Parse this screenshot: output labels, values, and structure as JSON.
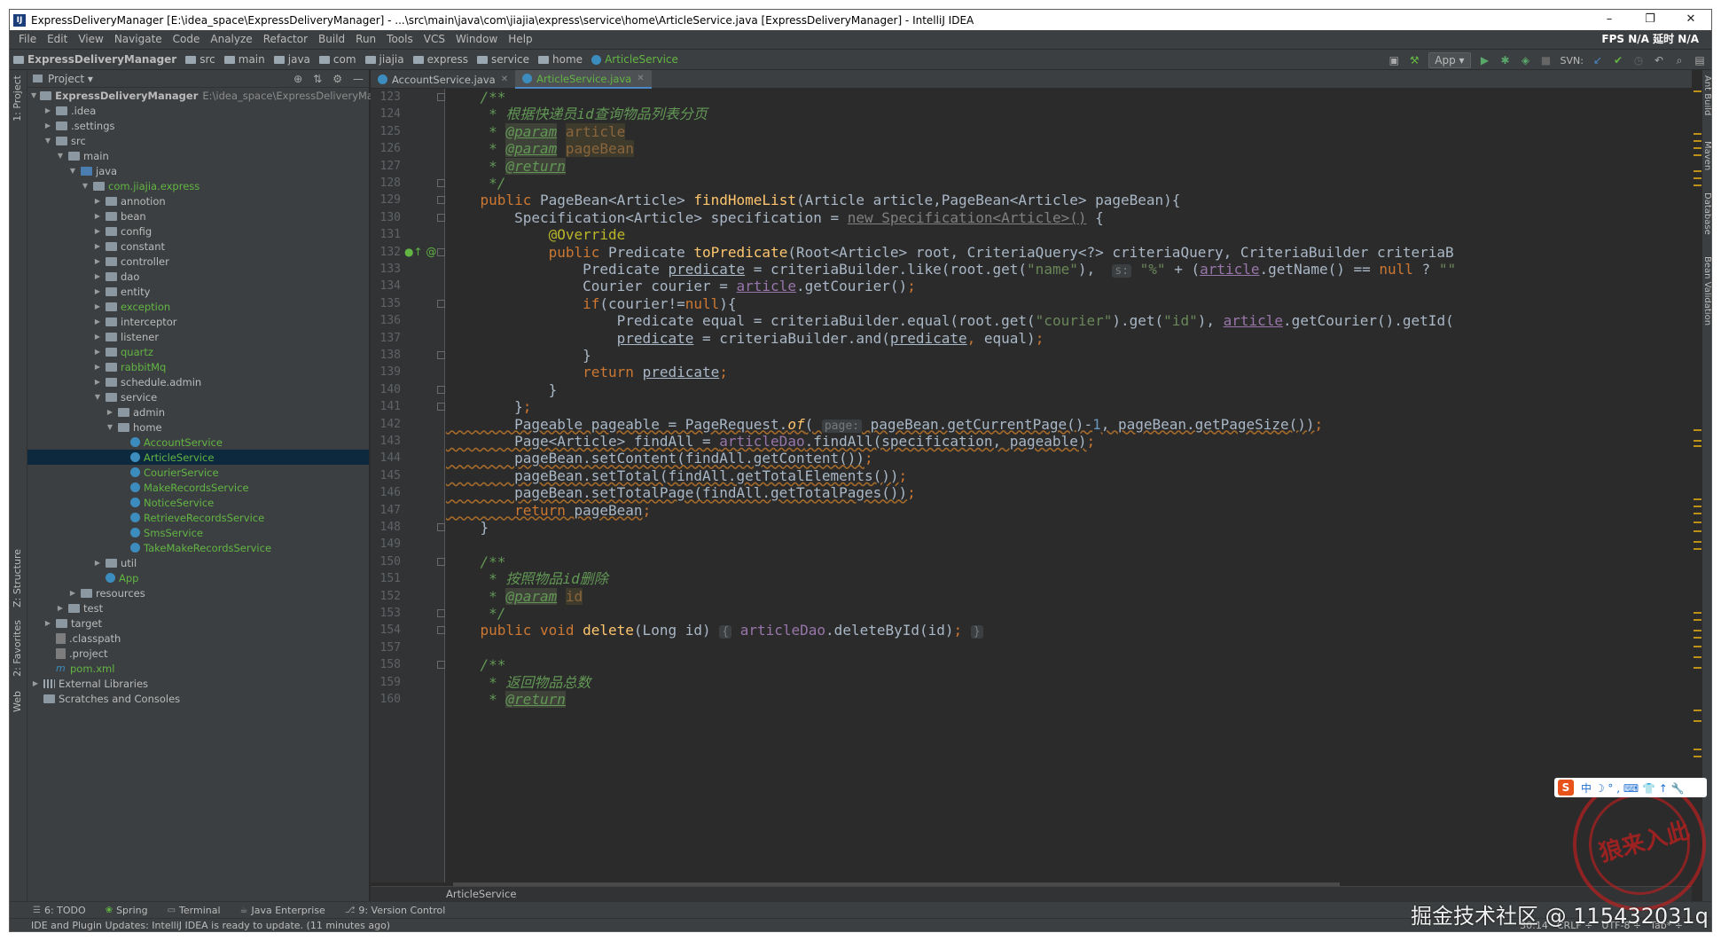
{
  "window": {
    "title": "ExpressDeliveryManager [E:\\idea_space\\ExpressDeliveryManager] - ...\\src\\main\\java\\com\\jiajia\\express\\service\\home\\ArticleService.java [ExpressDeliveryManager] - IntelliJ IDEA",
    "app_icon": "IJ",
    "controls": {
      "minimize": "–",
      "maximize": "❐",
      "close": "✕"
    }
  },
  "menu": {
    "items": [
      "File",
      "Edit",
      "View",
      "Navigate",
      "Code",
      "Analyze",
      "Refactor",
      "Build",
      "Run",
      "Tools",
      "VCS",
      "Window",
      "Help"
    ],
    "right_status": "FPS  N/A  延时  N/A"
  },
  "navbar": {
    "crumbs": [
      "ExpressDeliveryManager",
      "src",
      "main",
      "java",
      "com",
      "jiajia",
      "express",
      "service",
      "home",
      "ArticleService"
    ],
    "run_config": "App ▾",
    "svn_label": "SVN:"
  },
  "left_stripe": {
    "project": "1: Project",
    "structure": "Z: Structure",
    "favorites": "2: Favorites",
    "web": "Web"
  },
  "project_panel": {
    "header": "Project ▾",
    "tree": [
      {
        "label": "ExpressDeliveryManager",
        "path": "E:\\idea_space\\ExpressDeliveryManager",
        "indent": 0,
        "arrow": "down",
        "icon": "folder",
        "bold": true
      },
      {
        "label": ".idea",
        "indent": 1,
        "arrow": "right",
        "icon": "folder"
      },
      {
        "label": ".settings",
        "indent": 1,
        "arrow": "right",
        "icon": "folder"
      },
      {
        "label": "src",
        "indent": 1,
        "arrow": "down",
        "icon": "folder"
      },
      {
        "label": "main",
        "indent": 2,
        "arrow": "down",
        "icon": "folder"
      },
      {
        "label": "java",
        "indent": 3,
        "arrow": "down",
        "icon": "src"
      },
      {
        "label": "com.jiajia.express",
        "indent": 4,
        "arrow": "down",
        "icon": "pkg",
        "green": true
      },
      {
        "label": "annotion",
        "indent": 5,
        "arrow": "right",
        "icon": "pkg"
      },
      {
        "label": "bean",
        "indent": 5,
        "arrow": "right",
        "icon": "pkg"
      },
      {
        "label": "config",
        "indent": 5,
        "arrow": "right",
        "icon": "pkg"
      },
      {
        "label": "constant",
        "indent": 5,
        "arrow": "right",
        "icon": "pkg"
      },
      {
        "label": "controller",
        "indent": 5,
        "arrow": "right",
        "icon": "pkg"
      },
      {
        "label": "dao",
        "indent": 5,
        "arrow": "right",
        "icon": "pkg"
      },
      {
        "label": "entity",
        "indent": 5,
        "arrow": "right",
        "icon": "pkg"
      },
      {
        "label": "exception",
        "indent": 5,
        "arrow": "right",
        "icon": "pkg",
        "green": true
      },
      {
        "label": "interceptor",
        "indent": 5,
        "arrow": "right",
        "icon": "pkg"
      },
      {
        "label": "listener",
        "indent": 5,
        "arrow": "right",
        "icon": "pkg"
      },
      {
        "label": "quartz",
        "indent": 5,
        "arrow": "right",
        "icon": "pkg",
        "green": true
      },
      {
        "label": "rabbitMq",
        "indent": 5,
        "arrow": "right",
        "icon": "pkg",
        "green": true
      },
      {
        "label": "schedule.admin",
        "indent": 5,
        "arrow": "right",
        "icon": "pkg"
      },
      {
        "label": "service",
        "indent": 5,
        "arrow": "down",
        "icon": "pkg"
      },
      {
        "label": "admin",
        "indent": 6,
        "arrow": "right",
        "icon": "pkg"
      },
      {
        "label": "home",
        "indent": 6,
        "arrow": "down",
        "icon": "pkg"
      },
      {
        "label": "AccountService",
        "indent": 7,
        "arrow": "",
        "icon": "cls",
        "green": true
      },
      {
        "label": "ArticleService",
        "indent": 7,
        "arrow": "",
        "icon": "cls",
        "green": true,
        "selected": true
      },
      {
        "label": "CourierService",
        "indent": 7,
        "arrow": "",
        "icon": "cls",
        "green": true
      },
      {
        "label": "MakeRecordsService",
        "indent": 7,
        "arrow": "",
        "icon": "cls",
        "green": true
      },
      {
        "label": "NoticeService",
        "indent": 7,
        "arrow": "",
        "icon": "cls",
        "green": true
      },
      {
        "label": "RetrieveRecordsService",
        "indent": 7,
        "arrow": "",
        "icon": "cls",
        "green": true
      },
      {
        "label": "SmsService",
        "indent": 7,
        "arrow": "",
        "icon": "cls",
        "green": true
      },
      {
        "label": "TakeMakeRecordsService",
        "indent": 7,
        "arrow": "",
        "icon": "cls",
        "green": true
      },
      {
        "label": "util",
        "indent": 5,
        "arrow": "right",
        "icon": "pkg"
      },
      {
        "label": "App",
        "indent": 5,
        "arrow": "",
        "icon": "cls",
        "green": true
      },
      {
        "label": "resources",
        "indent": 3,
        "arrow": "right",
        "icon": "folder"
      },
      {
        "label": "test",
        "indent": 2,
        "arrow": "right",
        "icon": "folder"
      },
      {
        "label": "target",
        "indent": 1,
        "arrow": "right",
        "icon": "folder"
      },
      {
        "label": ".classpath",
        "indent": 1,
        "arrow": "",
        "icon": "file"
      },
      {
        "label": ".project",
        "indent": 1,
        "arrow": "",
        "icon": "file"
      },
      {
        "label": "pom.xml",
        "indent": 1,
        "arrow": "",
        "icon": "mvn",
        "green": true
      },
      {
        "label": "External Libraries",
        "indent": 0,
        "arrow": "right",
        "icon": "lib"
      },
      {
        "label": "Scratches and Consoles",
        "indent": 0,
        "arrow": "",
        "icon": "folder"
      }
    ]
  },
  "editor": {
    "tabs": [
      {
        "label": "AccountService.java",
        "active": false
      },
      {
        "label": "ArticleService.java",
        "active": true
      }
    ],
    "line_numbers": [
      "123",
      "124",
      "125",
      "126",
      "127",
      "128",
      "129",
      "130",
      "131",
      "132",
      "133",
      "134",
      "135",
      "136",
      "137",
      "138",
      "139",
      "140",
      "141",
      "142",
      "143",
      "144",
      "145",
      "146",
      "147",
      "148",
      "149",
      "150",
      "151",
      "152",
      "153",
      "154",
      "157",
      "158",
      "159",
      "160"
    ],
    "lines": [
      [
        [
          "cmt",
          "    /**"
        ]
      ],
      [
        [
          "cmt",
          "     * 根据快递员id查询物品列表分页"
        ]
      ],
      [
        [
          "cmt",
          "     * "
        ],
        [
          "cmt-tag",
          "@param"
        ],
        [
          "cmt",
          " "
        ],
        [
          "cmt-param",
          "article"
        ]
      ],
      [
        [
          "cmt",
          "     * "
        ],
        [
          "cmt-tag",
          "@param"
        ],
        [
          "cmt",
          " "
        ],
        [
          "cmt-param",
          "pageBean"
        ]
      ],
      [
        [
          "cmt",
          "     * "
        ],
        [
          "cmt-tag",
          "@return"
        ]
      ],
      [
        [
          "cmt",
          "     */"
        ]
      ],
      [
        [
          "kw",
          "    public "
        ],
        [
          "",
          "PageBean<Article> "
        ],
        [
          "fn",
          "findHomeList"
        ],
        [
          "",
          "(Article article,PageBean<Article> pageBean){"
        ]
      ],
      [
        [
          "",
          "        Specification<Article> specification = "
        ],
        [
          "deprec",
          "new Specification<Article>()"
        ],
        [
          "",
          " {"
        ]
      ],
      [
        [
          "ann",
          "            @Override"
        ]
      ],
      [
        [
          "kw",
          "            public "
        ],
        [
          "",
          "Predicate "
        ],
        [
          "fn",
          "toPredicate"
        ],
        [
          "",
          "(Root<Article> root, CriteriaQuery<?> criteriaQuery, CriteriaBuilder criteriaB"
        ]
      ],
      [
        [
          "",
          "                Predicate "
        ],
        [
          "ul",
          "predicate"
        ],
        [
          "",
          " = criteriaBuilder.like(root.get("
        ],
        [
          "str",
          "\"name\""
        ],
        [
          "",
          "),  "
        ],
        [
          "hint",
          "s:"
        ],
        [
          "str",
          " \"%\""
        ],
        [
          "",
          " + ("
        ],
        [
          "ul field",
          "article"
        ],
        [
          "",
          ".getName() == "
        ],
        [
          "kw",
          "null"
        ],
        [
          "",
          " ? "
        ],
        [
          "str",
          "\"\""
        ]
      ],
      [
        [
          "",
          "                Courier courier = "
        ],
        [
          "ul field",
          "article"
        ],
        [
          "",
          ".getCourier()"
        ],
        [
          "kw",
          ";"
        ]
      ],
      [
        [
          "kw",
          "                if"
        ],
        [
          "",
          "(courier!="
        ],
        [
          "kw",
          "null"
        ],
        [
          "",
          "){"
        ]
      ],
      [
        [
          "",
          "                    Predicate equal = criteriaBuilder.equal(root.get("
        ],
        [
          "str",
          "\"courier\""
        ],
        [
          "",
          ").get("
        ],
        [
          "str",
          "\"id\""
        ],
        [
          "",
          "), "
        ],
        [
          "ul field",
          "article"
        ],
        [
          "",
          ".getCourier().getId("
        ]
      ],
      [
        [
          "",
          "                    "
        ],
        [
          "ul",
          "predicate"
        ],
        [
          "",
          " = criteriaBuilder.and("
        ],
        [
          "ul",
          "predicate"
        ],
        [
          "kw",
          ", "
        ],
        [
          "",
          "equal)"
        ],
        [
          "kw",
          ";"
        ]
      ],
      [
        [
          "",
          "                }"
        ]
      ],
      [
        [
          "kw",
          "                return "
        ],
        [
          "ul",
          "predicate"
        ],
        [
          "kw",
          ";"
        ]
      ],
      [
        [
          "",
          "            }"
        ]
      ],
      [
        [
          "",
          "        }"
        ],
        [
          "kw",
          ";"
        ]
      ],
      [
        [
          "wavy",
          "        Pageable pageable = PageRequest."
        ],
        [
          "wavy fn-it",
          "of"
        ],
        [
          "wavy",
          "( "
        ],
        [
          "hint",
          "page:"
        ],
        [
          "wavy",
          " pageBean.getCurrentPage()-"
        ],
        [
          "num",
          "1"
        ],
        [
          "wavy",
          ", pageBean.getPageSize())"
        ],
        [
          "kw",
          ";"
        ]
      ],
      [
        [
          "wavy",
          "        Page<Article> findAll = "
        ],
        [
          "field wavy",
          "articleDao"
        ],
        [
          "wavy",
          ".findAll(specification, pageable)"
        ],
        [
          "kw",
          ";"
        ]
      ],
      [
        [
          "wavy",
          "        pageBean.setContent(findAll.getContent())"
        ],
        [
          "kw",
          ";"
        ]
      ],
      [
        [
          "wavy",
          "        pageBean.setTotal(findAll.getTotalElements())"
        ],
        [
          "kw",
          ";"
        ]
      ],
      [
        [
          "wavy",
          "        pageBean.setTotalPage(findAll.getTotalPages())"
        ],
        [
          "kw",
          ";"
        ]
      ],
      [
        [
          "kw wavy",
          "        return "
        ],
        [
          "wavy",
          "pageBean"
        ],
        [
          "kw",
          ";"
        ]
      ],
      [
        [
          "",
          "    }"
        ]
      ],
      [
        [
          "",
          ""
        ]
      ],
      [
        [
          "cmt",
          "    /**"
        ]
      ],
      [
        [
          "cmt",
          "     * 按照物品id删除"
        ]
      ],
      [
        [
          "cmt",
          "     * "
        ],
        [
          "cmt-tag",
          "@param"
        ],
        [
          "cmt",
          " "
        ],
        [
          "cmt-param",
          "id"
        ]
      ],
      [
        [
          "cmt",
          "     */"
        ]
      ],
      [
        [
          "kw",
          "    public void "
        ],
        [
          "fn",
          "delete"
        ],
        [
          "",
          "(Long id) "
        ],
        [
          "hint",
          "{"
        ],
        [
          "",
          " "
        ],
        [
          "field",
          "articleDao"
        ],
        [
          "",
          ".deleteById(id)"
        ],
        [
          "kw",
          ";"
        ],
        [
          "",
          " "
        ],
        [
          "hint",
          "}"
        ]
      ],
      [
        [
          "",
          ""
        ]
      ],
      [
        [
          "cmt",
          "    /**"
        ]
      ],
      [
        [
          "cmt",
          "     * 返回物品总数"
        ]
      ],
      [
        [
          "cmt",
          "     * "
        ],
        [
          "cmt-tag",
          "@return"
        ]
      ]
    ],
    "breadcrumb": "ArticleService"
  },
  "right_stripe": {
    "ant": "Ant Build",
    "maven": "Maven",
    "database": "Database",
    "bean": "Bean Validation"
  },
  "bottom_tools": [
    {
      "icon": "☰",
      "label": "6: TODO"
    },
    {
      "icon": "❀",
      "label": "Spring"
    },
    {
      "icon": "▭",
      "label": "Terminal"
    },
    {
      "icon": "☕",
      "label": "Java Enterprise"
    },
    {
      "icon": "⎇",
      "label": "9: Version Control"
    }
  ],
  "status": {
    "message": "IDE and Plugin Updates: IntelliJ IDEA is ready to update. (11 minutes ago)",
    "position": "30:14",
    "line_sep": "CRLF ÷",
    "encoding": "UTF-8 ÷",
    "indent": "Tab* ÷"
  },
  "overlays": {
    "ime": "中 ☽ ° , ⌨ 👕 ↑ 🔧",
    "ime_logo": "S",
    "watermark": "掘金技术社区 @ 115432031q",
    "stamp": "狼来入此"
  }
}
